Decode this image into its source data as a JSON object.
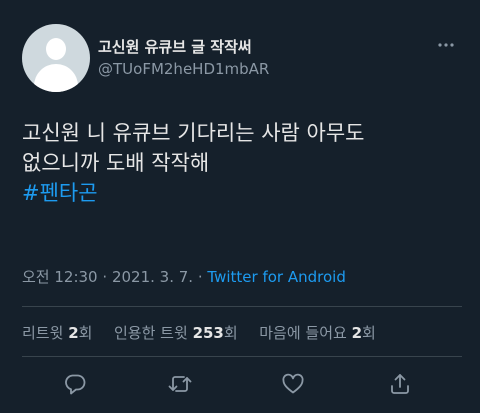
{
  "tweet": {
    "display_name": "고신원 유큐브 글 작작써",
    "handle": "@TUoFM2heHD1mbAR",
    "more_icon": "more-horizontal-icon",
    "text_lines": [
      "고신원 니 유큐브 기다리는 사람 아무도",
      "없으니까 도배 작작해"
    ],
    "hashtag": "#펜타곤",
    "time": "오전 12:30",
    "date": "2021. 3. 7.",
    "separator": "·",
    "source": "Twitter for Android"
  },
  "stats": {
    "retweets_label": "리트윗",
    "retweets_count": "2",
    "retweets_unit": "회",
    "quotes_label": "인용한 트윗",
    "quotes_count": "253",
    "quotes_unit": "회",
    "likes_label": "마음에 들어요",
    "likes_count": "2",
    "likes_unit": "회"
  },
  "actions": [
    {
      "name": "reply",
      "icon": "reply-icon"
    },
    {
      "name": "retweet",
      "icon": "retweet-icon"
    },
    {
      "name": "like",
      "icon": "heart-icon"
    },
    {
      "name": "share",
      "icon": "share-icon"
    }
  ],
  "colors": {
    "background": "#15202b",
    "accent": "#1d9bf0",
    "secondary_text": "#8b98a5",
    "divider": "#38444d"
  }
}
